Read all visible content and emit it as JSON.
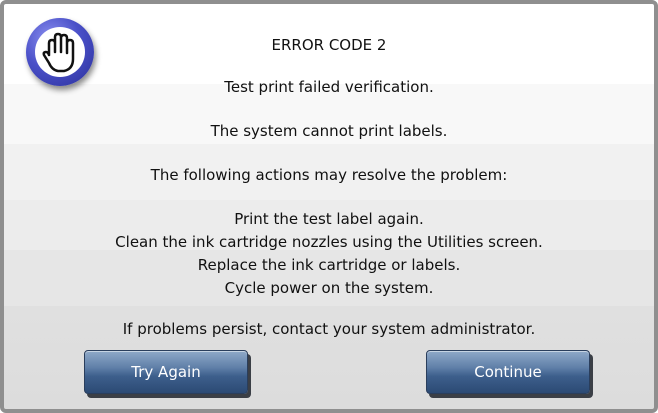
{
  "dialog": {
    "icon": "stop-hand-icon",
    "title": "ERROR CODE 2",
    "messages": [
      "Test print failed verification.",
      "The system cannot print labels.",
      "The following actions may resolve the problem:"
    ],
    "actions": [
      "Print the test label again.",
      "Clean the ink cartridge nozzles using the Utilities screen.",
      "Replace the ink cartridge or labels.",
      "Cycle power on the system."
    ],
    "footer_message": "If problems persist, contact your system administrator.",
    "buttons": {
      "try_again": "Try Again",
      "continue": "Continue"
    }
  },
  "colors": {
    "badge": "#4a50c8",
    "button": "#3d5f8c"
  }
}
